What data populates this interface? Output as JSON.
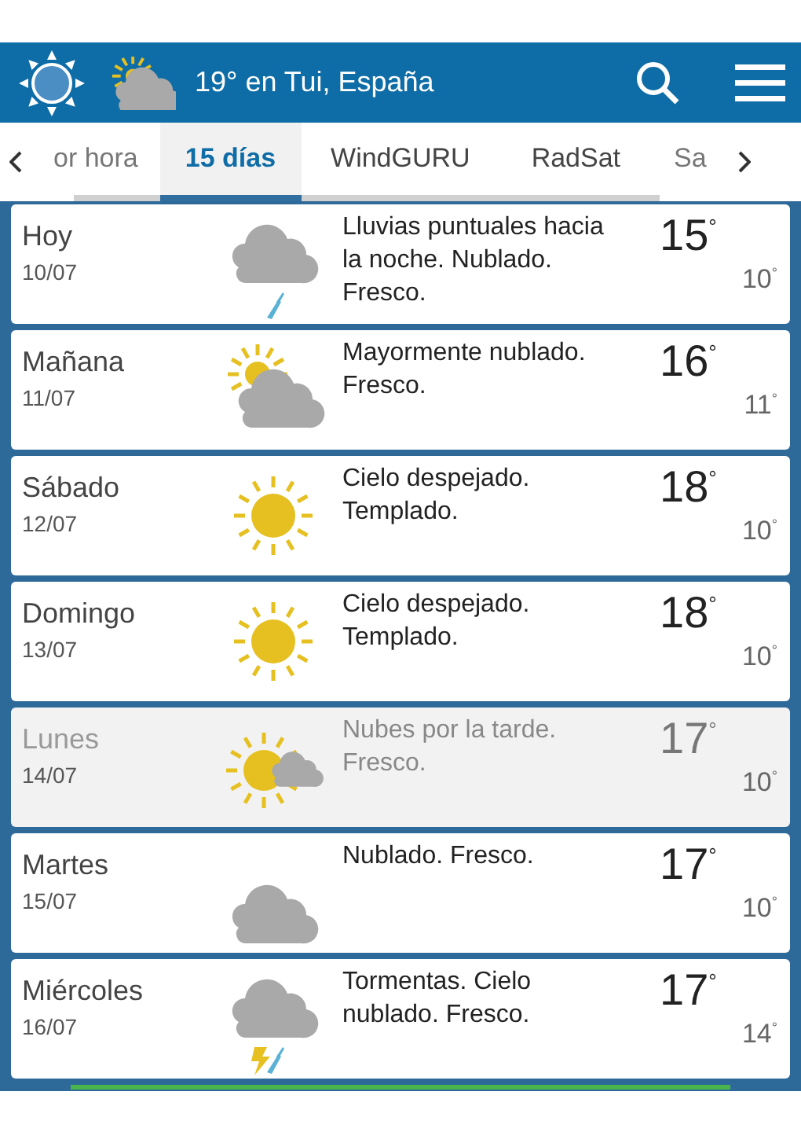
{
  "header": {
    "title": "19° en Tui, España"
  },
  "tabs": [
    {
      "label": "or hora",
      "selected": false
    },
    {
      "label": "15 días",
      "selected": true
    },
    {
      "label": "WindGURU",
      "selected": false
    },
    {
      "label": "RadSat",
      "selected": false
    },
    {
      "label": "Sa",
      "selected": false
    }
  ],
  "days": [
    {
      "day": "Hoy",
      "date": "10/07",
      "kind": "rain",
      "summary": "Lluvias puntuales hacia la noche. Nublado. Fresco.",
      "high": "15$^{°}$",
      "low": "10$^{°}$",
      "dimmed": false
    },
    {
      "day": "Mañana",
      "date": "11/07",
      "kind": "partly_cloudy",
      "summary": "Mayormente nublado. Fresco.",
      "high": "16$^{°}$",
      "low": "11$^{°}$",
      "dimmed": false
    },
    {
      "day": "Sábado",
      "date": "12/07",
      "kind": "sunny",
      "summary": "Cielo despejado. Templado.",
      "high": "18$^{°}$",
      "low": "10$^{°}$",
      "dimmed": false
    },
    {
      "day": "Domingo",
      "date": "13/07",
      "kind": "sunny",
      "summary": "Cielo despejado. Templado.",
      "high": "18$^{°}$",
      "low": "10$^{°}$",
      "dimmed": false
    },
    {
      "day": "Lunes",
      "date": "14/07",
      "kind": "sun_cloud",
      "summary": "Nubes por la tarde. Fresco.",
      "high": "17$^{°}$",
      "low": "10$^{°}$",
      "dimmed": true
    },
    {
      "day": "Martes",
      "date": "15/07",
      "kind": "cloudy",
      "summary": "Nublado. Fresco.",
      "high": "17$^{°}$",
      "low": "10$^{°}$",
      "dimmed": false
    },
    {
      "day": "Miércoles",
      "date": "16/07",
      "kind": "storm",
      "summary": "Tormentas. Cielo nublado. Fresco.",
      "high": "17$^{°}$",
      "low": "14$^{°}$",
      "dimmed": false
    }
  ]
}
